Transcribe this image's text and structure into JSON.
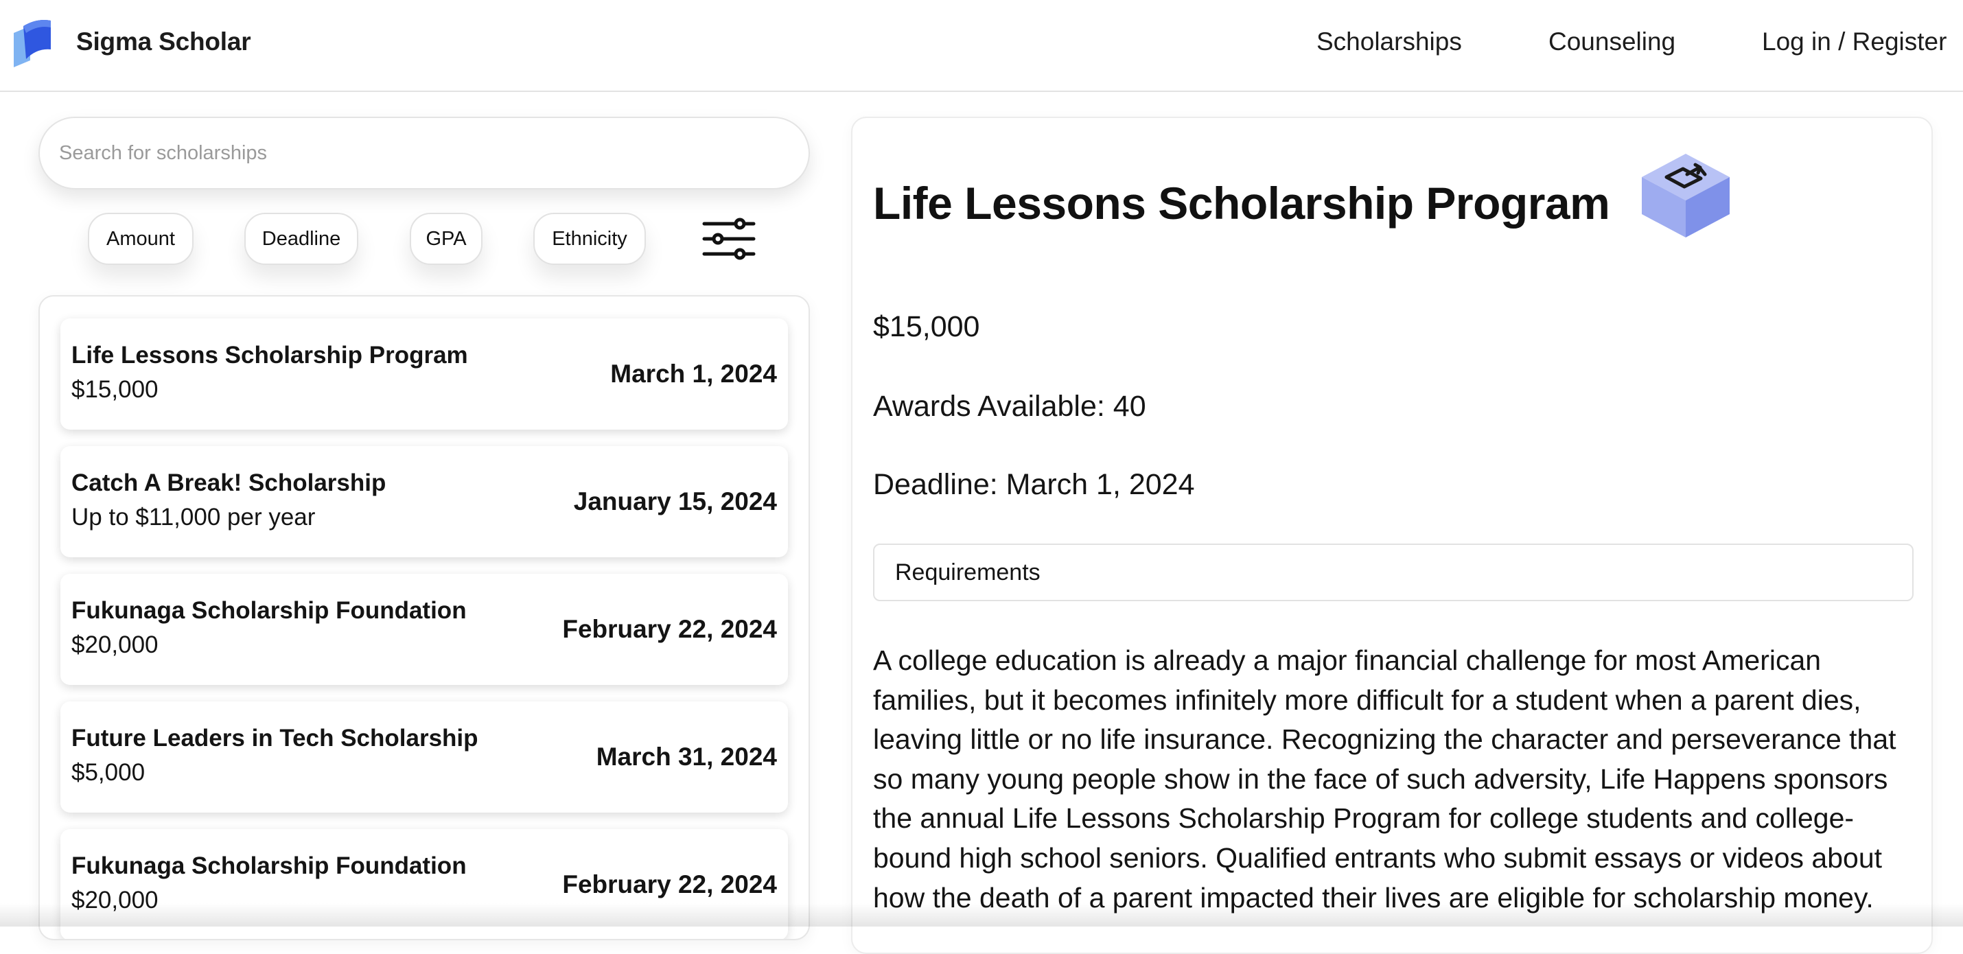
{
  "header": {
    "brand": "Sigma Scholar",
    "logo_icon": "sigma-scholar-logo",
    "nav": [
      "Scholarships",
      "Counseling",
      "Log in / Register"
    ]
  },
  "search": {
    "placeholder": "Search for scholarships",
    "value": ""
  },
  "filters": {
    "chips": [
      "Amount",
      "Deadline",
      "GPA",
      "Ethnicity"
    ],
    "advanced_icon": "sliders-icon"
  },
  "scholarships": [
    {
      "title": "Life Lessons Scholarship Program",
      "amount": "$15,000",
      "deadline": "March 1, 2024"
    },
    {
      "title": "Catch A Break! Scholarship",
      "amount": "Up to $11,000 per year",
      "deadline": "January 15, 2024"
    },
    {
      "title": "Fukunaga Scholarship Foundation",
      "amount": "$20,000",
      "deadline": "February 22, 2024"
    },
    {
      "title": "Future Leaders in Tech Scholarship",
      "amount": "$5,000",
      "deadline": "March 31, 2024"
    },
    {
      "title": "Fukunaga Scholarship Foundation",
      "amount": "$20,000",
      "deadline": "February 22, 2024"
    }
  ],
  "detail": {
    "title": "Life Lessons Scholarship Program",
    "share_icon": "share-box-icon",
    "amount": "$15,000",
    "awards": "Awards Available: 40",
    "deadline": "Deadline: March 1, 2024",
    "requirements_label": "Requirements",
    "description": "A college education is already a major financial challenge for most American families, but it becomes infinitely more difficult for a student when a parent dies, leaving little or no life insurance. Recognizing the character and perseverance that so many young people show in the face of such adversity, Life Happens sponsors the annual Life Lessons Scholarship Program for college students and college-bound high school seniors. Qualified entrants who submit essays or videos about how the death of a parent impacted their lives are eligible for scholarship money."
  },
  "colors": {
    "logo_dark": "#2f57e0",
    "logo_light": "#7fb3f2",
    "cube_top": "#b8c2f5",
    "cube_side": "#8f9fee"
  }
}
